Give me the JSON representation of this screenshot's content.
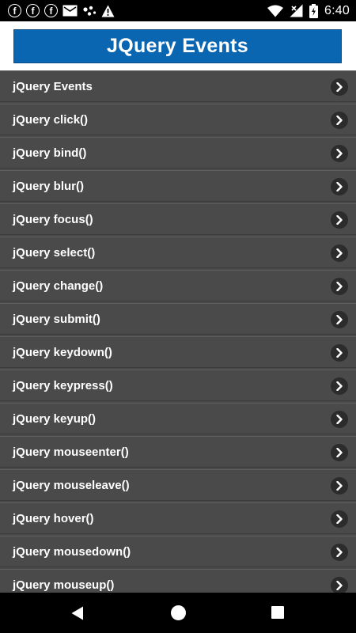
{
  "status_bar": {
    "left_icons": [
      "facebook-icon",
      "facebook-icon",
      "facebook-icon",
      "mail-icon",
      "dots-icon",
      "warning-icon"
    ],
    "facebook_glyph": "f",
    "right_icons": [
      "wifi-icon",
      "signal-icon",
      "battery-icon"
    ],
    "time": "6:40"
  },
  "header": {
    "title": "JQuery Events",
    "background_color": "#0b66b1"
  },
  "list": {
    "items": [
      {
        "label": "jQuery Events"
      },
      {
        "label": "jQuery click()"
      },
      {
        "label": "jQuery bind()"
      },
      {
        "label": "jQuery blur()"
      },
      {
        "label": "jQuery focus()"
      },
      {
        "label": "jQuery select()"
      },
      {
        "label": "jQuery change()"
      },
      {
        "label": "jQuery submit()"
      },
      {
        "label": "jQuery keydown()"
      },
      {
        "label": "jQuery keypress()"
      },
      {
        "label": "jQuery keyup()"
      },
      {
        "label": "jQuery mouseenter()"
      },
      {
        "label": "jQuery mouseleave()"
      },
      {
        "label": "jQuery hover()"
      },
      {
        "label": "jQuery mousedown()"
      },
      {
        "label": "jQuery mouseup()"
      }
    ],
    "row_color": "#4a4a4a",
    "chevron_icon": "chevron-right-icon"
  },
  "nav_bar": {
    "buttons": [
      "back-icon",
      "home-icon",
      "recent-apps-icon"
    ]
  }
}
